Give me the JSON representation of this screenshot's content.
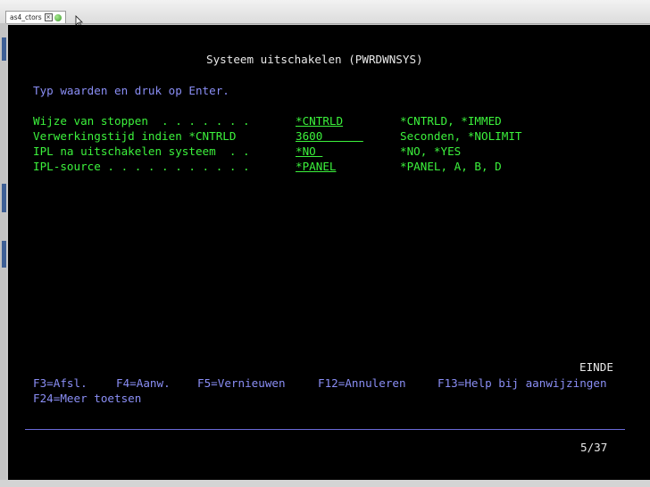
{
  "window": {
    "tab_label": "as4_ctors",
    "tab_close_glyph": "×"
  },
  "terminal": {
    "title": "Systeem uitschakelen (PWRDWNSYS)",
    "instruction": "Typ waarden en druk op Enter.",
    "fields": [
      {
        "label": "Wijze van stoppen  . . . . . . .",
        "value": "*CNTRLD",
        "options": "*CNTRLD, *IMMED"
      },
      {
        "label": "Verwerkingstijd indien *CNTRLD  ",
        "value": "3600      ",
        "options": "Seconden, *NOLIMIT"
      },
      {
        "label": "IPL na uitschakelen systeem  . .",
        "value": "*NO ",
        "options": "*NO, *YES"
      },
      {
        "label": "IPL-source . . . . . . . . . . .",
        "value": "*PANEL",
        "options": "*PANEL, A, B, D"
      }
    ],
    "end_marker": "EINDE",
    "function_keys": [
      "F3=Afsl.",
      "F4=Aanw.",
      "F5=Vernieuwen",
      "F12=Annuleren",
      "F13=Help bij aanwijzingen",
      "F24=Meer toetsen"
    ],
    "status_position": "5/37"
  },
  "colors": {
    "background": "#000000",
    "title_text": "#e9e9e9",
    "prompt_text": "#8a8ef5",
    "field_text": "#3cf23c"
  }
}
